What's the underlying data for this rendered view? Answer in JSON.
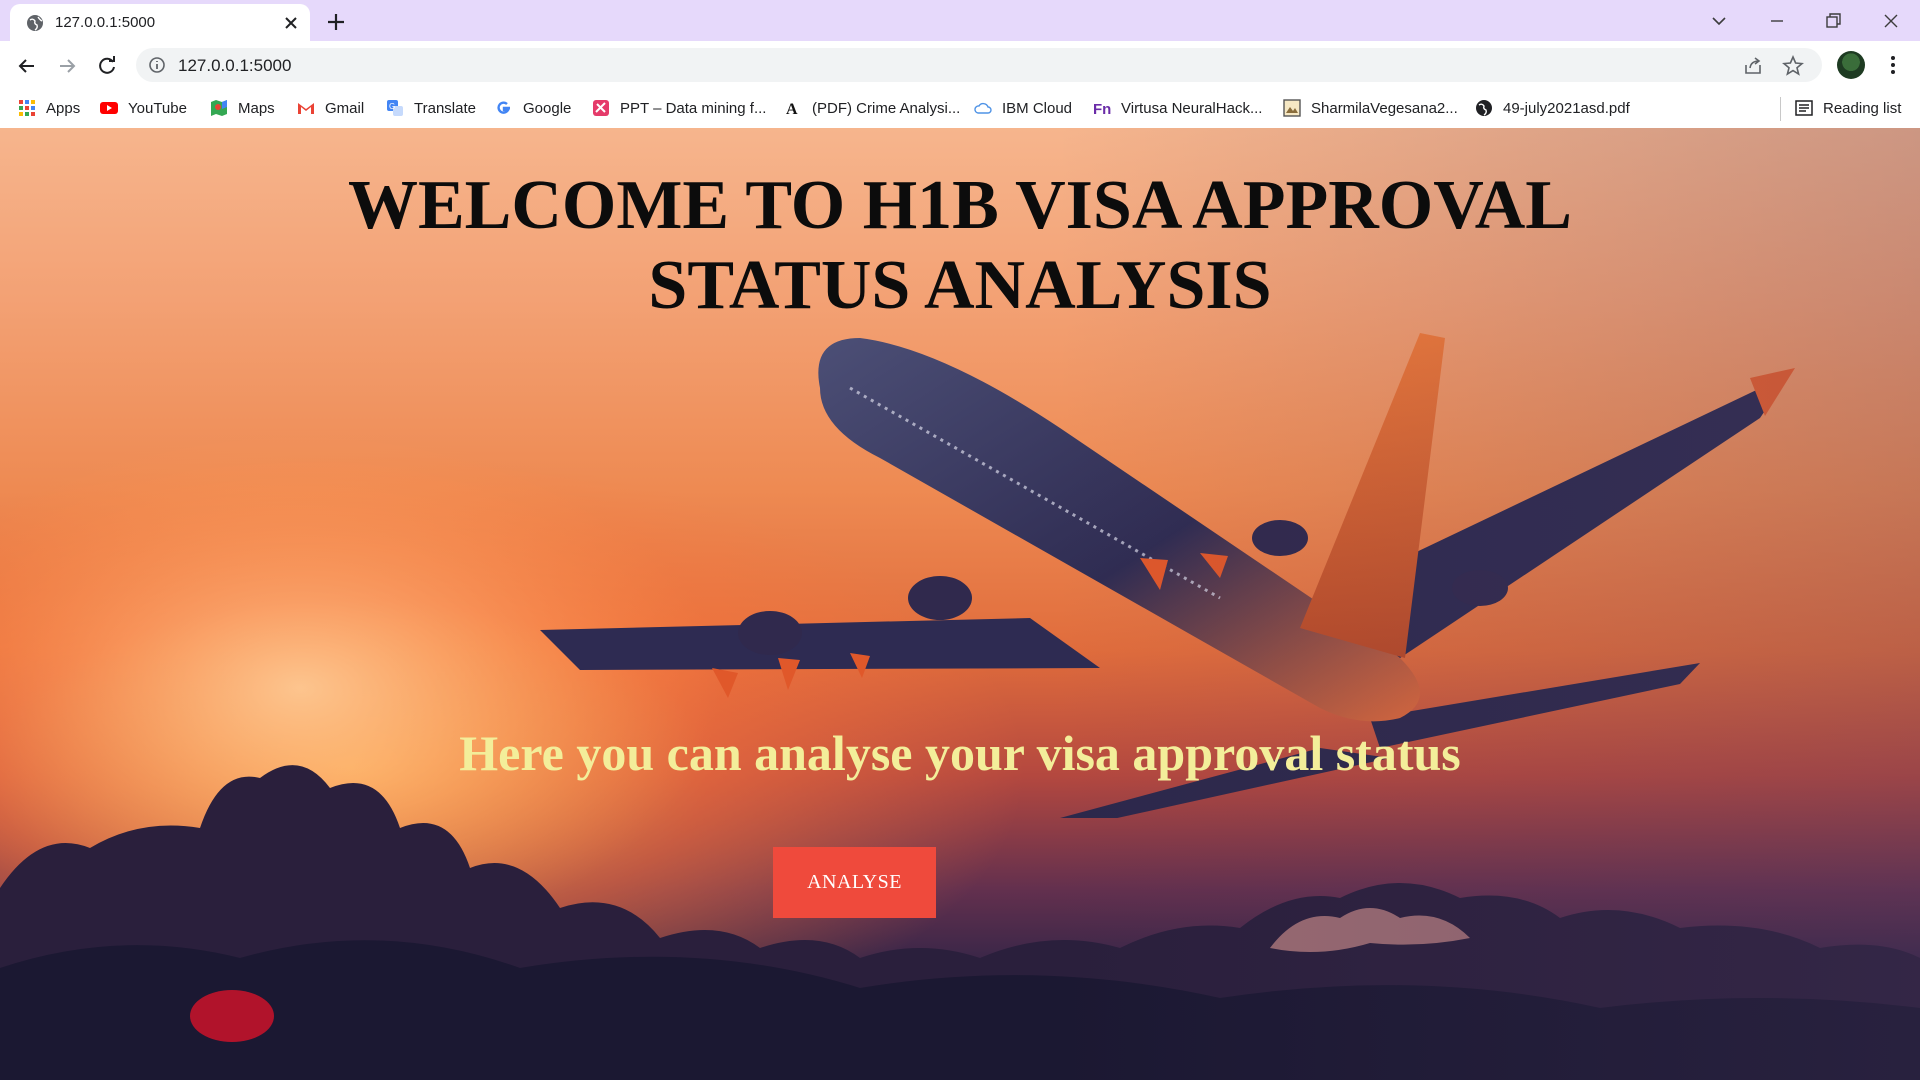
{
  "browser": {
    "tab_title": "127.0.0.1:5000",
    "url": "127.0.0.1:5000",
    "bookmarks": [
      {
        "label": "Apps",
        "icon": "apps-grid-icon"
      },
      {
        "label": "YouTube",
        "icon": "youtube-icon"
      },
      {
        "label": "Maps",
        "icon": "maps-icon"
      },
      {
        "label": "Gmail",
        "icon": "gmail-icon"
      },
      {
        "label": "Translate",
        "icon": "translate-icon"
      },
      {
        "label": "Google",
        "icon": "google-icon"
      },
      {
        "label": "PPT – Data mining f...",
        "icon": "ppt-icon"
      },
      {
        "label": "(PDF) Crime Analysi...",
        "icon": "academia-icon"
      },
      {
        "label": "IBM Cloud",
        "icon": "ibm-cloud-icon"
      },
      {
        "label": "Virtusa NeuralHack...",
        "icon": "fn-icon"
      },
      {
        "label": "SharmilaVegesana2...",
        "icon": "image-file-icon"
      },
      {
        "label": "49-july2021asd.pdf",
        "icon": "globe-icon"
      }
    ],
    "reading_list": "Reading list"
  },
  "page": {
    "title_line1": "WELCOME TO H1B VISA APPROVAL",
    "title_line2": "STATUS ANALYSIS",
    "subtitle": "Here you can analyse your visa approval status",
    "button_label": "ANALYSE"
  },
  "colors": {
    "tab_strip": "#e6d9fb",
    "subtitle": "#f3ee9a",
    "button": "#ef4a3c",
    "sky_top": "#f6b58d",
    "sky_bottom": "#1d1c3e"
  }
}
